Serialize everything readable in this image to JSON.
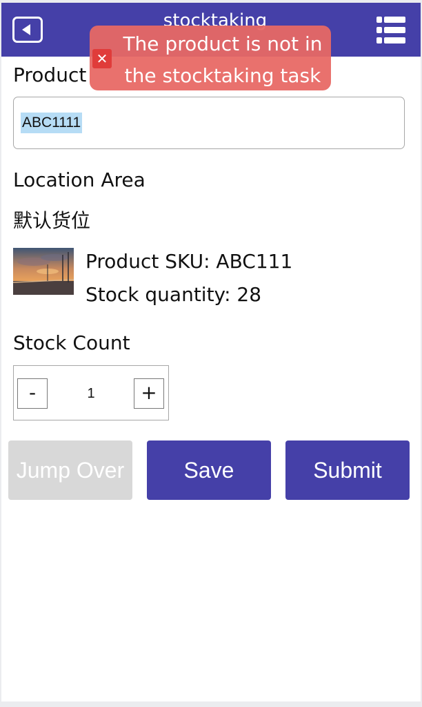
{
  "header": {
    "title": "stocktaking",
    "back_icon": "back-arrow-icon",
    "menu_icon": "list-menu-icon",
    "color": "#4540a8"
  },
  "toast": {
    "icon": "close-icon",
    "icon_glyph": "✕",
    "message": "The product is not in the stocktaking task",
    "color": "#e86864"
  },
  "product": {
    "label": "Product",
    "value": "ABC1111"
  },
  "location": {
    "label": "Location Area",
    "value": "默认货位"
  },
  "sku_info": {
    "image": "product-thumbnail",
    "sku_line": "Product SKU: ABC111",
    "stock_line": "Stock quantity: 28"
  },
  "stock_count": {
    "label": "Stock Count",
    "minus": "-",
    "value": "1",
    "plus": "+"
  },
  "actions": {
    "jump_over": "Jump Over",
    "save": "Save",
    "submit": "Submit",
    "disabled_color": "#d8d8d8"
  }
}
